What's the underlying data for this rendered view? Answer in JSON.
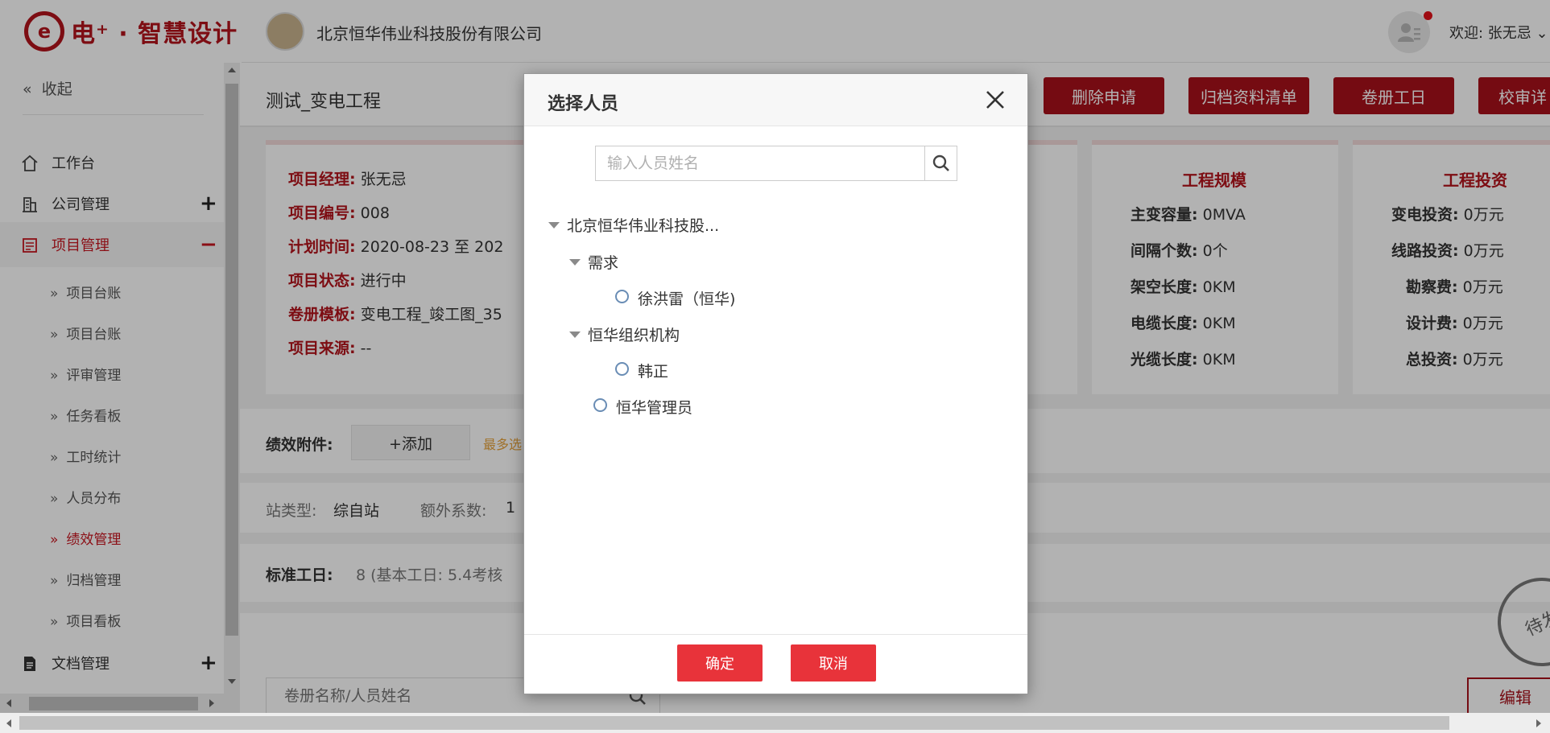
{
  "header": {
    "logo_mark": "e",
    "logo_text": "电⁺ · 智慧设计",
    "company_name": "北京恒华伟业科技股份有限公司",
    "welcome": "欢迎: 张无忌 ⌄"
  },
  "sidebar": {
    "collapse_label": "收起",
    "items": [
      {
        "label": "工作台",
        "icon": "home-icon"
      },
      {
        "label": "公司管理",
        "icon": "building-icon",
        "sign": "+"
      },
      {
        "label": "项目管理",
        "icon": "project-icon",
        "sign": "−"
      },
      {
        "label": "文档管理",
        "icon": "document-icon",
        "sign": "+"
      }
    ],
    "subitems": [
      "项目台账",
      "项目台账",
      "评审管理",
      "任务看板",
      "工时统计",
      "人员分布",
      "绩效管理",
      "归档管理",
      "项目看板"
    ],
    "active_subitem": "绩效管理"
  },
  "main": {
    "page_title": "测试_变电工程",
    "buttons": [
      "删除申请",
      "归档资料清单",
      "卷册工日",
      "校审详"
    ],
    "project_info": {
      "manager_label": "项目经理:",
      "manager": "张无忌",
      "code_label": "项目编号:",
      "code": "008",
      "time_label": "计划时间:",
      "time": "2020-08-23 至 202",
      "status_label": "项目状态:",
      "status": "进行中",
      "template_label": "卷册模板:",
      "template": "变电工程_竣工图_35",
      "source_label": "项目来源:",
      "source": "--"
    },
    "scale": {
      "title": "工程规模",
      "rows": [
        {
          "k": "主变容量:",
          "v": "0MVA"
        },
        {
          "k": "间隔个数:",
          "v": "0个"
        },
        {
          "k": "架空长度:",
          "v": "0KM"
        },
        {
          "k": "电缆长度:",
          "v": "0KM"
        },
        {
          "k": "光缆长度:",
          "v": "0KM"
        }
      ]
    },
    "investment": {
      "title": "工程投资",
      "rows": [
        {
          "k": "变电投资:",
          "v": "0万元"
        },
        {
          "k": "线路投资:",
          "v": "0万元"
        },
        {
          "k": "勘察费:",
          "v": "0万元"
        },
        {
          "k": "设计费:",
          "v": "0万元"
        },
        {
          "k": "总投资:",
          "v": "0万元"
        }
      ]
    },
    "attach_label": "绩效附件:",
    "add_label": "+添加",
    "attach_hint": "最多选",
    "site_type_label": "站类型:",
    "site_type": "综自站",
    "extra_coef_label": "额外系数:",
    "extra_coef": "1",
    "std_label": "标准工日:",
    "std_value": "8 (基本工日: 5.4考核",
    "list_search_placeholder": "卷册名称/人员姓名",
    "edit_label": "编辑",
    "stamp_text": "待发"
  },
  "modal": {
    "title": "选择人员",
    "search_placeholder": "输入人员姓名",
    "tree": {
      "root": "北京恒华伟业科技股...",
      "group1": "需求",
      "person1": "徐洪雷（恒华)",
      "group2": "恒华组织机构",
      "person2": "韩正",
      "person3": "恒华管理员"
    },
    "confirm_label": "确定",
    "cancel_label": "取消"
  },
  "colors": {
    "brand": "#b4141c",
    "button_dark": "#a8111a",
    "modal_button": "#e8333a",
    "active_text": "#c81620",
    "hint": "#e6a23c"
  }
}
